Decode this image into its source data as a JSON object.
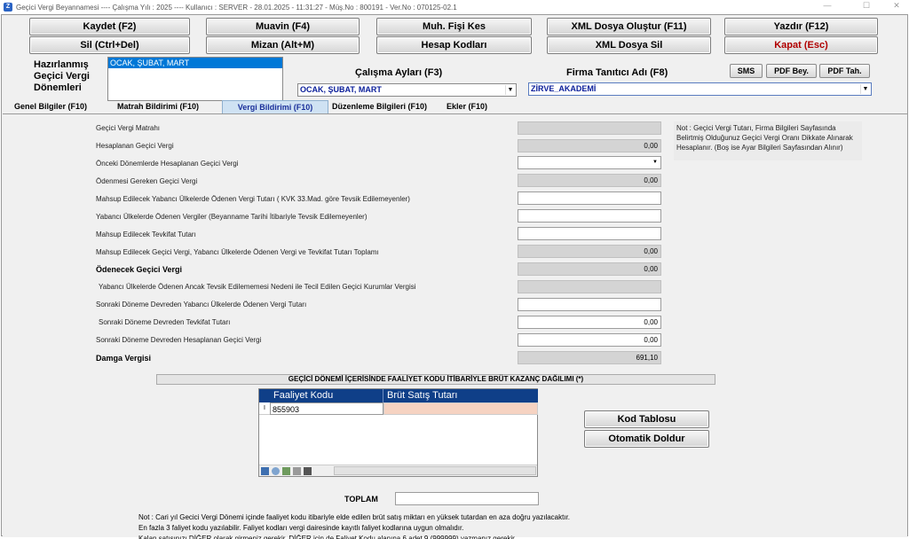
{
  "window": {
    "title": "Geçici Vergi Beyannamesi  ----  Çalışma Yılı : 2025  ----  Kullanıcı : SERVER - 28.01.2025 - 11:31:27 - Müş.No : 800191 - Ver.No : 070125-02.1",
    "min": "—",
    "max": "☐",
    "close": "✕",
    "icon": "Z"
  },
  "toolbar": {
    "save": "Kaydet (F2)",
    "muavin": "Muavin (F4)",
    "muh_fisi": "Muh. Fişi Kes",
    "xml_create": "XML Dosya Oluştur (F11)",
    "print": "Yazdır (F12)",
    "delete": "Sil (Ctrl+Del)",
    "mizan": "Mizan (Alt+M)",
    "hesap_kodlari": "Hesap Kodları",
    "xml_delete": "XML Dosya Sil",
    "close": "Kapat (Esc)"
  },
  "prepared": {
    "label": "Hazırlanmış Geçici Vergi Dönemleri",
    "items": [
      "OCAK, ŞUBAT, MART"
    ]
  },
  "period": {
    "label": "Çalışma Ayları (F3)",
    "value": "OCAK, ŞUBAT, MART"
  },
  "firm": {
    "label": "Firma Tanıtıcı Adı (F8)",
    "value": "ZİRVE_AKADEMİ"
  },
  "small_buttons": {
    "sms": "SMS",
    "pdf_bey": "PDF Bey.",
    "pdf_tah": "PDF Tah."
  },
  "tabs": [
    "Genel Bilgiler (F10)",
    "Matrah Bildirimi (F10)",
    "Vergi Bildirimi (F10)",
    "Düzenleme Bilgileri (F10)",
    "Ekler (F10)"
  ],
  "rows": [
    {
      "label": "Geçici Vergi Matrahı",
      "value": ""
    },
    {
      "label": "Hesaplanan Geçici Vergi",
      "value": "0,00"
    },
    {
      "label": "Önceki Dönemlerde Hesaplanan Geçici Vergi",
      "value": ""
    },
    {
      "label": "Ödenmesi Gereken Geçici Vergi",
      "value": "0,00"
    },
    {
      "label": "Mahsup Edilecek Yabancı Ülkelerde Ödenen Vergi Tutarı ( KVK 33.Mad. göre Tevsik Edilemeyenler)",
      "value": ""
    },
    {
      "label": "Yabancı Ülkelerde Ödenen Vergiler (Beyanname Tarihi İtibariyle Tevsik Edilemeyenler)",
      "value": ""
    },
    {
      "label": "Mahsup Edilecek Tevkifat Tutarı",
      "value": ""
    },
    {
      "label": "Mahsup Edilecek Geçici Vergi, Yabancı Ülkelerde Ödenen Vergi ve Tevkifat Tutarı Toplamı",
      "value": "0,00"
    },
    {
      "label": "Ödenecek Geçici Vergi",
      "value": "0,00"
    },
    {
      "label": "Yabancı Ülkelerde Ödenen Ancak Tevsik Edilememesi Nedeni ile Tecil Edilen Geçici Kurumlar Vergisi",
      "value": ""
    },
    {
      "label": "Sonraki Döneme Devreden Yabancı Ülkelerde Ödenen Vergi Tutarı",
      "value": ""
    },
    {
      "label": "Sonraki Döneme Devreden Tevkifat Tutarı",
      "value": "0,00"
    },
    {
      "label": "Sonraki Döneme Devreden Hesaplanan Geçici Vergi",
      "value": "0,00"
    },
    {
      "label": "Damga Vergisi",
      "value": "691,10"
    }
  ],
  "note_right": "Not : Geçici Vergi Tutarı, Firma Bilgileri Sayfasında Belirtmiş Olduğunuz Geçici Vergi Oranı Dikkate Alınarak Hesaplanır. (Boş ise Ayar Bilgileri Sayfasından Alınır)",
  "section_title": "GEÇİCİ DÖNEMİ İÇERİSİNDE FAALİYET KODU İTİBARİYLE BRÜT KAZANÇ DAĞILIMI (*)",
  "grid": {
    "columns": [
      "Faaliyet Kodu",
      "Brüt Satış Tutarı"
    ],
    "rows": [
      {
        "marker": "I",
        "code": "855903",
        "amount": ""
      }
    ]
  },
  "side_buttons": {
    "kod_tablosu": "Kod Tablosu",
    "otomatik": "Otomatik Doldur"
  },
  "total": {
    "label": "TOPLAM",
    "value": ""
  },
  "notes": [
    "Not : Cari yıl Gecici Vergi Dönemi içinde faaliyet kodu itibariyle elde edilen brüt satış miktarı en yüksek tutardan en aza doğru yazılacaktır.",
    "En fazla 3 faliyet kodu yazılabilir.      Faliyet kodları vergi dairesinde kayıtlı faliyet kodlarına uygun olmalıdır.",
    "Kalan satışınızı DİĞER olarak girmeniz gerekir.  DİĞER için de Faliyet Kodu alanına 6 adet 9 (999999) yazmanız gerekir."
  ]
}
